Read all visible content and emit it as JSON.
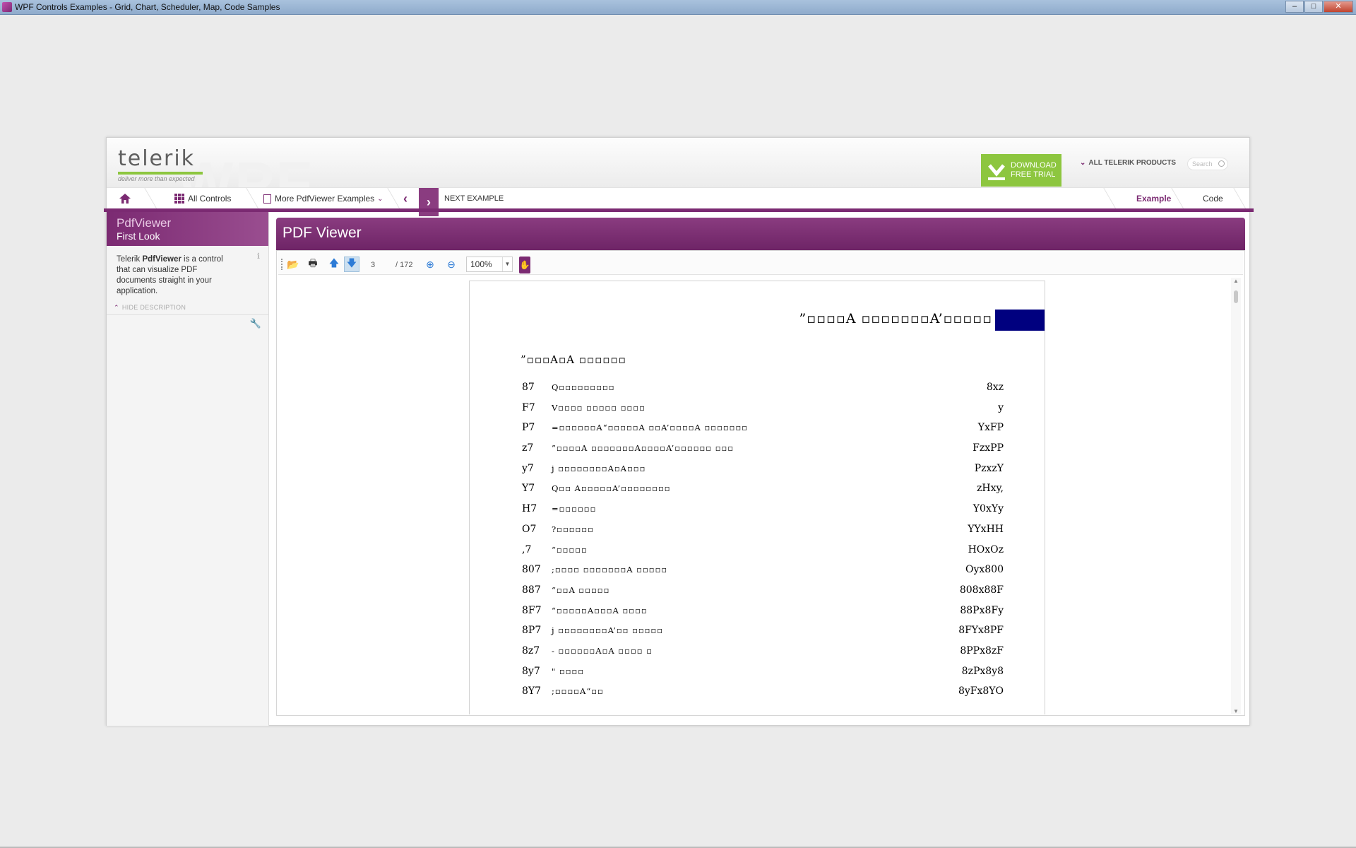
{
  "window": {
    "title": "WPF Controls Examples - Grid, Chart, Scheduler, Map, Code Samples",
    "controls": [
      "–",
      "□",
      "✕"
    ]
  },
  "header": {
    "watermark": "WPF",
    "logo_text": "telerik",
    "tagline": "deliver more than expected",
    "download_line1": "DOWNLOAD",
    "download_line2": "FREE TRIAL",
    "all_products": "ALL TELERIK PRODUCTS",
    "search_placeholder": "Search"
  },
  "nav": {
    "all_controls": "All Controls",
    "more_examples": "More PdfViewer Examples",
    "next_example": "NEXT EXAMPLE",
    "tab_example": "Example",
    "tab_code": "Code"
  },
  "sidebar": {
    "title": "PdfViewer",
    "subtitle": "First Look",
    "desc_prefix": "Telerik ",
    "desc_bold": "PdfViewer",
    "desc_suffix": " is a control that can visualize PDF documents straight in your application.",
    "hide_description": "HIDE DESCRIPTION"
  },
  "panel": {
    "title": "PDF Viewer"
  },
  "toolbar": {
    "current_page": "3",
    "total_pages": "/ 172",
    "zoom": "100%"
  },
  "document": {
    "title": "”▫▫▫▫A ▫▫▫▫▫▫▫A’▫▫▫▫▫",
    "subtitle": "”▫▫▫A▫A ▫▫▫▫▫▫",
    "toc": [
      {
        "num": "87",
        "text": "Q▫▫▫▫▫▫▫▫▫",
        "page": "8xz"
      },
      {
        "num": "F7",
        "text": "V▫▫▫▫ ▫▫▫▫▫ ▫▫▫▫",
        "page": "y"
      },
      {
        "num": "P7",
        "text": "=▫▫▫▫▫▫A“▫▫▫▫▫A ▫▫A’▫▫▫▫A ▫▫▫▫▫▫▫",
        "page": "YxFP"
      },
      {
        "num": "z7",
        "text": "”▫▫▫▫A ▫▫▫▫▫▫▫A▫▫▫▫A’▫▫▫▫▫▫ ▫▫▫",
        "page": "FzxPP"
      },
      {
        "num": "y7",
        "text": "j ▫▫▫▫▫▫▫▫A▫A▫▫▫",
        "page": "PzxzY"
      },
      {
        "num": "Y7",
        "text": "Q▫▫ A▫▫▫▫▫A’▫▫▫▫▫▫▫▫",
        "page": "zHxy,"
      },
      {
        "num": "H7",
        "text": "=▫▫▫▫▫▫",
        "page": "Y0xYy"
      },
      {
        "num": "O7",
        "text": "?▫▫▫▫▫▫",
        "page": "YYxHH"
      },
      {
        "num": ",7",
        "text": "“▫▫▫▫▫",
        "page": "HOxOz"
      },
      {
        "num": "807",
        "text": ";▫▫▫▫ ▫▫▫▫▫▫▫A ▫▫▫▫▫",
        "page": "Oyx800"
      },
      {
        "num": "887",
        "text": "“▫▫A ▫▫▫▫▫",
        "page": "808x88F"
      },
      {
        "num": "8F7",
        "text": "“▫▫▫▫▫A▫▫▫A ▫▫▫▫",
        "page": "88Px8Fy"
      },
      {
        "num": "8P7",
        "text": "j ▫▫▫▫▫▫▫▫A’▫▫ ▫▫▫▫▫",
        "page": "8FYx8PF"
      },
      {
        "num": "8z7",
        "text": "- ▫▫▫▫▫▫A▫A ▫▫▫▫ ▫",
        "page": "8PPx8zF"
      },
      {
        "num": "8y7",
        "text": "\" ▫▫▫▫",
        "page": "8zPx8y8"
      },
      {
        "num": "8Y7",
        "text": ";▫▫▫▫A“▫▫",
        "page": "8yFx8YO"
      }
    ]
  },
  "colors": {
    "brand_purple": "#7b2a72",
    "brand_green": "#8dc63f",
    "doc_block": "#00007f"
  }
}
